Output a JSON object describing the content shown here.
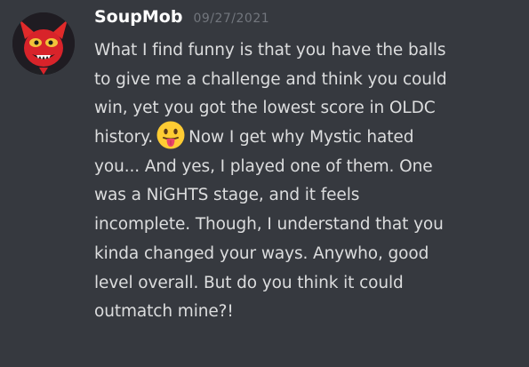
{
  "message": {
    "author": "SoupMob",
    "timestamp": "09/27/2021",
    "avatar_icon": "red-demon-character-avatar",
    "emoji": "face-with-tongue",
    "lines": [
      "What I find funny is that you have the balls",
      "to give me a challenge and think you could",
      "win, yet you got the lowest score in OLDC",
      "history.",
      "Now I get why Mystic hated",
      "you... And yes, I played one of them. One",
      "was a NiGHTS stage, and it feels",
      "incomplete. Though, I understand that you",
      "kinda changed your ways. Anywho, good",
      "level overall. But do you think it could",
      "outmatch mine?!"
    ]
  },
  "colors": {
    "background": "#36393f",
    "username": "#ffffff",
    "timestamp": "#72767d",
    "text": "#dcddde",
    "emoji_face": "#ffcc33",
    "emoji_tongue": "#e8456b"
  }
}
